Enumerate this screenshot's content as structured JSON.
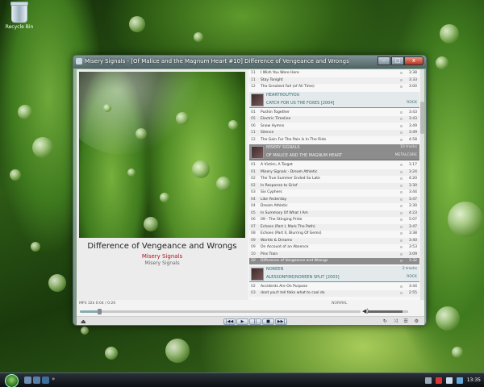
{
  "desktop": {
    "recycle_bin_label": "Recycle Bin"
  },
  "window": {
    "title": "Misery Signals - [Of Malice and the Magnum Heart #10] Difference of Vengeance and Wrongs",
    "min_glyph": "–",
    "max_glyph": "□",
    "close_glyph": "x"
  },
  "now_playing": {
    "title": "Difference of Vengeance and Wrongs",
    "artist": "Misery Signals",
    "album": "Misery Signals",
    "info": "MP3 32k   0:04 / 0:20",
    "mode": "NORMAL",
    "position_fraction": 0.07,
    "volume_fraction": 0.85
  },
  "controls": {
    "prev": "|◀◀",
    "play": "▶",
    "pause": "||",
    "stop": "■",
    "next": "▶▶|",
    "eject": "⏏",
    "volume_icon": "◀)",
    "right_icons": "↻ ⤨ ☰ ⚙"
  },
  "playlist": {
    "top_rows": [
      {
        "num": "11",
        "title": "I Wish You Were Here",
        "duration": "3:38"
      },
      {
        "num": "11",
        "title": "Stay Tonight",
        "duration": "3:33"
      },
      {
        "num": "12",
        "title": "The Greatest Fall (of All Time)",
        "duration": "3:00"
      }
    ],
    "album1": {
      "artist": "HEARTHOUTYOU",
      "album": "CATCH FOR US THE FOXES [2004]",
      "tracks": "",
      "genre": "ROCK"
    },
    "album1_rows": [
      {
        "num": "01",
        "title": "Pushin Together",
        "duration": "3:43"
      },
      {
        "num": "05",
        "title": "Electric Timeline",
        "duration": "3:43"
      },
      {
        "num": "06",
        "title": "Snow Hymns",
        "duration": "3:49"
      },
      {
        "num": "11",
        "title": "Silence",
        "duration": "3:49"
      },
      {
        "num": "12",
        "title": "The Gain For The Pain Is In The Ride",
        "duration": "4:58"
      }
    ],
    "album2": {
      "artist": "MISERY SIGNALS",
      "album": "OF MALICE AND THE MAGNUM HEART",
      "tracks": "10 tracks",
      "genre": "METALCORE"
    },
    "album2_rows": [
      {
        "num": "01",
        "title": "A Victim, A Target",
        "duration": "1:17"
      },
      {
        "num": "01",
        "title": "Misery Signals - Dream Athletic",
        "duration": "3:24"
      },
      {
        "num": "02",
        "title": "The True Summer Ended So Late",
        "duration": "4:20"
      },
      {
        "num": "02",
        "title": "In Response to Grief",
        "duration": "3:30"
      },
      {
        "num": "03",
        "title": "Six Cyphers",
        "duration": "3:44"
      },
      {
        "num": "04",
        "title": "Like Yesterday",
        "duration": "3:47"
      },
      {
        "num": "04",
        "title": "Dream Athletic",
        "duration": "3:30"
      },
      {
        "num": "05",
        "title": "In Summary Of What I Am",
        "duration": "4:23"
      },
      {
        "num": "06",
        "title": "09 - The Stinging Pride",
        "duration": "5:07"
      },
      {
        "num": "07",
        "title": "Echoes (Part I, Mark The Path)",
        "duration": "3:47"
      },
      {
        "num": "08",
        "title": "Echoes (Part II, Blurring Of Gems)",
        "duration": "3:38"
      },
      {
        "num": "09",
        "title": "Worlds & Dreams",
        "duration": "3:40"
      },
      {
        "num": "09",
        "title": "On Account of an Absence",
        "duration": "3:53"
      },
      {
        "num": "10",
        "title": "Pins Train",
        "duration": "3:09"
      }
    ],
    "playing_row": {
      "num": "10",
      "title": "Difference of Vengeance and Wrongs",
      "duration": "1:32"
    },
    "album3": {
      "artist": "NOREEN",
      "album": "ALESSONFIRE/NOREEN SPLIT [2003]",
      "tracks": "2 tracks",
      "genre": "ROCK"
    },
    "album3_rows": [
      {
        "num": "02",
        "title": "Accidents Are On Purpose",
        "duration": "3:44"
      },
      {
        "num": "03",
        "title": "dont you't tell folks what to cool do",
        "duration": "2:55"
      }
    ]
  },
  "taskbar": {
    "clock": "13:35",
    "show_desktop": "»"
  },
  "colors": {
    "accent": "#2f6d75",
    "artist_red": "#b0121c",
    "playing_row": "#8c8c8c"
  }
}
